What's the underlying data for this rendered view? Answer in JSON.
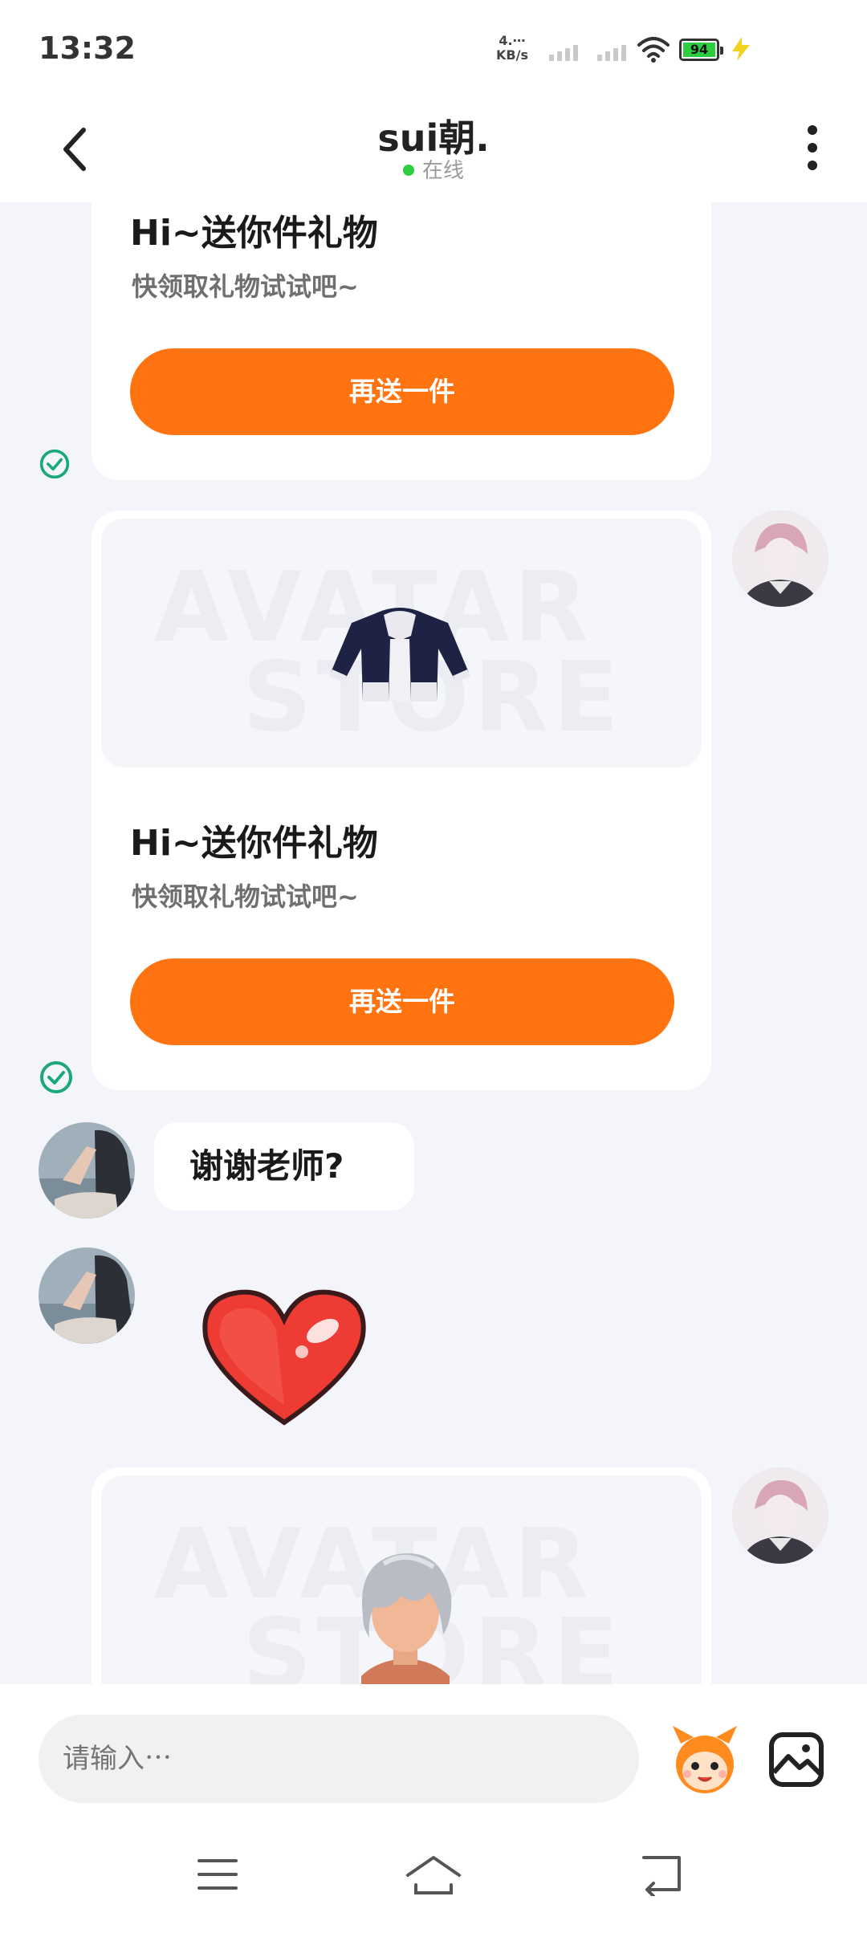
{
  "status_bar": {
    "time": "13:32",
    "net_speed_value": "4.⋯",
    "net_speed_unit": "KB/s",
    "battery_level": "94",
    "colors": {
      "battery": "#2ecc40",
      "charge_bolt": "#f2d320"
    }
  },
  "header": {
    "back_icon": "chevron-left-icon",
    "title": "sui朝.",
    "status": "在线",
    "status_color": "#2ecc40",
    "more_icon": "vertical-dots-icon"
  },
  "messages": {
    "gift1": {
      "title": "Hi~送你件礼物",
      "subtitle": "快领取礼物试试吧~",
      "button": "再送一件"
    },
    "gift2": {
      "title": "Hi~送你件礼物",
      "subtitle": "快领取礼物试试吧~",
      "button": "再送一件",
      "item": "jacket"
    },
    "text_reply": "谢谢老师?",
    "sticker": "heart",
    "gift3": {
      "item": "hair"
    },
    "watermark_line1": "AVATAR",
    "watermark_line2": "STORE"
  },
  "input_bar": {
    "placeholder": "请输入⋯",
    "emoji_icon": "mascot-emoji-icon",
    "image_icon": "image-icon"
  },
  "nav_bar": {
    "icons": [
      "menu-icon",
      "home-icon",
      "back-icon"
    ]
  },
  "colors": {
    "accent": "#ff7410",
    "check": "#1aa77a",
    "background": "#f3f5fa"
  }
}
